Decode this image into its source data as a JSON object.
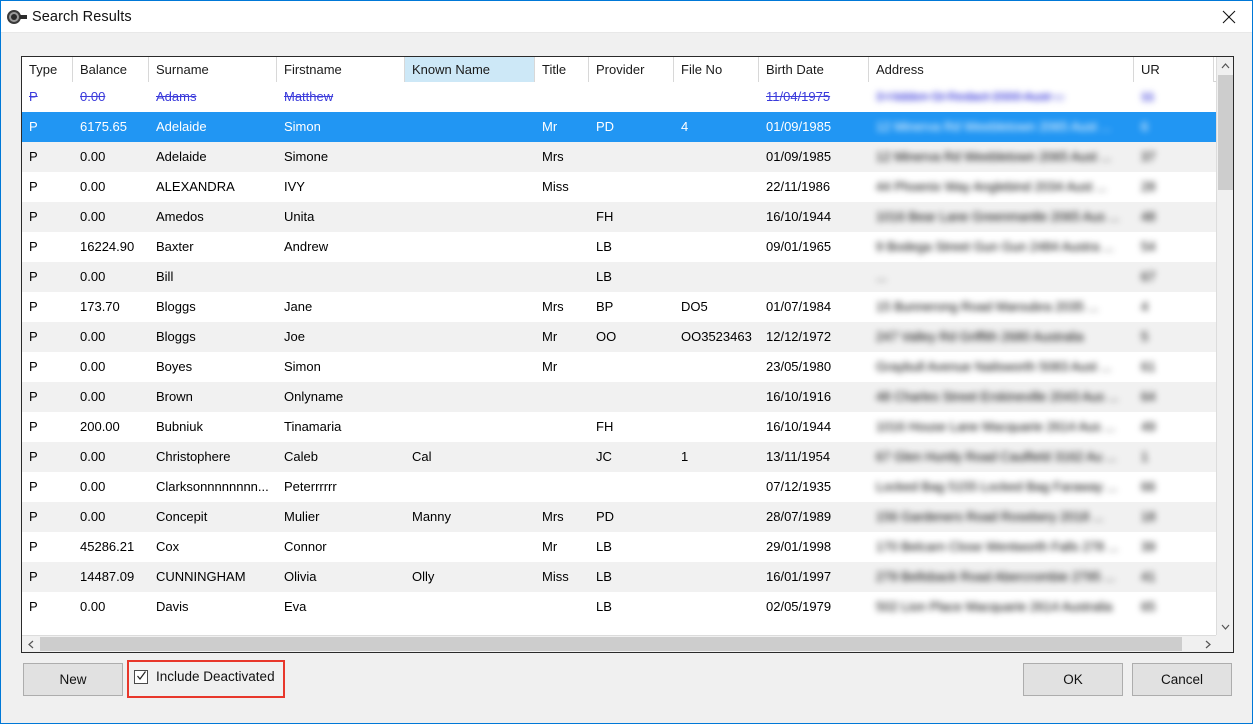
{
  "window": {
    "title": "Search Results",
    "title_icon": "search-magnifier-icon",
    "close_icon": "close-icon",
    "accent_color": "#0078d7",
    "selection_color": "#2196f3",
    "deactivated_color": "#3b3bdb",
    "annotation_color": "#e8372b",
    "header_highlight_color": "#cde8f7"
  },
  "grid": {
    "sorted_column": "Known Name",
    "columns": [
      {
        "label": "Type",
        "key": "type"
      },
      {
        "label": "Balance",
        "key": "balance"
      },
      {
        "label": "Surname",
        "key": "surname"
      },
      {
        "label": "Firstname",
        "key": "firstname"
      },
      {
        "label": "Known Name",
        "key": "known_name"
      },
      {
        "label": "Title",
        "key": "title"
      },
      {
        "label": "Provider",
        "key": "provider"
      },
      {
        "label": "File No",
        "key": "file_no"
      },
      {
        "label": "Birth Date",
        "key": "birth_date"
      },
      {
        "label": "Address",
        "key": "address"
      },
      {
        "label": "UR",
        "key": "ur"
      }
    ],
    "rows": [
      {
        "type": "P",
        "balance": "0.00",
        "surname": "Adams",
        "firstname": "Matthew",
        "known_name": "",
        "title": "",
        "provider": "",
        "file_no": "",
        "birth_date": "11/04/1975",
        "address": "3 Hidden St Redact 2000 Aust ...",
        "ur": "11",
        "state": "deactivated"
      },
      {
        "type": "P",
        "balance": "6175.65",
        "surname": "Adelaide",
        "firstname": "Simon",
        "known_name": "",
        "title": "Mr",
        "provider": "PD",
        "file_no": "4",
        "birth_date": "01/09/1985",
        "address": "12 Minerva Rd Weebletown 2065 Aust ...",
        "ur": "6",
        "state": "selected"
      },
      {
        "type": "P",
        "balance": "0.00",
        "surname": "Adelaide",
        "firstname": "Simone",
        "known_name": "",
        "title": "Mrs",
        "provider": "",
        "file_no": "",
        "birth_date": "01/09/1985",
        "address": "12 Minerva Rd Weebletown 2065 Aust ...",
        "ur": "37",
        "state": "alt"
      },
      {
        "type": "P",
        "balance": "0.00",
        "surname": "ALEXANDRA",
        "firstname": "IVY",
        "known_name": "",
        "title": "Miss",
        "provider": "",
        "file_no": "",
        "birth_date": "22/11/1986",
        "address": "44 Phoenix Way Anglebind 2034 Aust ...",
        "ur": "28",
        "state": ""
      },
      {
        "type": "P",
        "balance": "0.00",
        "surname": "Amedos",
        "firstname": "Unita",
        "known_name": "",
        "title": "",
        "provider": "FH",
        "file_no": "",
        "birth_date": "16/10/1944",
        "address": "1016 Bear Lane Greenmantle 2065 Aus ...",
        "ur": "48",
        "state": "alt"
      },
      {
        "type": "P",
        "balance": "16224.90",
        "surname": "Baxter",
        "firstname": "Andrew",
        "known_name": "",
        "title": "",
        "provider": "LB",
        "file_no": "",
        "birth_date": "09/01/1965",
        "address": "9 Bodega Street Gun Gun 2484 Austra ...",
        "ur": "54",
        "state": ""
      },
      {
        "type": "P",
        "balance": "0.00",
        "surname": "Bill",
        "firstname": "",
        "known_name": "",
        "title": "",
        "provider": "LB",
        "file_no": "",
        "birth_date": "",
        "address": "...",
        "ur": "67",
        "state": "alt"
      },
      {
        "type": "P",
        "balance": "173.70",
        "surname": "Bloggs",
        "firstname": "Jane",
        "known_name": "",
        "title": "Mrs",
        "provider": "BP",
        "file_no": "DO5",
        "birth_date": "01/07/1984",
        "address": "15 Bunnerong Road  Maroubra  2035 ...",
        "ur": "4",
        "state": ""
      },
      {
        "type": "P",
        "balance": "0.00",
        "surname": "Bloggs",
        "firstname": "Joe",
        "known_name": "",
        "title": "Mr",
        "provider": "OO",
        "file_no": "OO3523463",
        "birth_date": "12/12/1972",
        "address": "247 Valley Rd Griffith  2680  Australia",
        "ur": "5",
        "state": "alt"
      },
      {
        "type": "P",
        "balance": "0.00",
        "surname": "Boyes",
        "firstname": "Simon",
        "known_name": "",
        "title": "Mr",
        "provider": "",
        "file_no": "",
        "birth_date": "23/05/1980",
        "address": "Graybull Avenue  Nailsworth  5083 Aust ...",
        "ur": "61",
        "state": ""
      },
      {
        "type": "P",
        "balance": "0.00",
        "surname": "Brown",
        "firstname": "Onlyname",
        "known_name": "",
        "title": "",
        "provider": "",
        "file_no": "",
        "birth_date": "16/10/1916",
        "address": "48 Charles Street  Erskineville  2043  Aus ...",
        "ur": "64",
        "state": "alt"
      },
      {
        "type": "P",
        "balance": "200.00",
        "surname": "Bubniuk",
        "firstname": "Tinamaria",
        "known_name": "",
        "title": "",
        "provider": "FH",
        "file_no": "",
        "birth_date": "16/10/1944",
        "address": "1016 House Lane  Macquarie  2614  Aus ...",
        "ur": "49",
        "state": ""
      },
      {
        "type": "P",
        "balance": "0.00",
        "surname": "Christophere",
        "firstname": "Caleb",
        "known_name": "Cal",
        "title": "",
        "provider": "JC",
        "file_no": "1",
        "birth_date": "13/11/1954",
        "address": "67 Glen Huntly Road  Caulfield  3162  Au ...",
        "ur": "1",
        "state": "alt"
      },
      {
        "type": "P",
        "balance": "0.00",
        "surname": "Clarksonnnnnnnn...",
        "firstname": "Peterrrrrr",
        "known_name": "",
        "title": "",
        "provider": "",
        "file_no": "",
        "birth_date": "07/12/1935",
        "address": "Locked Bag 5155 Locked Bag  Faraway ...",
        "ur": "66",
        "state": ""
      },
      {
        "type": "P",
        "balance": "0.00",
        "surname": "Concepit",
        "firstname": "Mulier",
        "known_name": "Manny",
        "title": "Mrs",
        "provider": "PD",
        "file_no": "",
        "birth_date": "28/07/1989",
        "address": "156 Gardeners Road  Rosebery  2018 ...",
        "ur": "18",
        "state": "alt"
      },
      {
        "type": "P",
        "balance": "45286.21",
        "surname": "Cox",
        "firstname": "Connor",
        "known_name": "",
        "title": "Mr",
        "provider": "LB",
        "file_no": "",
        "birth_date": "29/01/1998",
        "address": "170 Belcarn Close  Wentworth Falls  278 ...",
        "ur": "39",
        "state": ""
      },
      {
        "type": "P",
        "balance": "14487.09",
        "surname": "CUNNINGHAM",
        "firstname": "Olivia",
        "known_name": "Olly",
        "title": "Miss",
        "provider": "LB",
        "file_no": "",
        "birth_date": "16/01/1997",
        "address": "279 Bellsback Road  Abercrombie  2795 ...",
        "ur": "41",
        "state": "alt"
      },
      {
        "type": "P",
        "balance": "0.00",
        "surname": "Davis",
        "firstname": "Eva",
        "known_name": "",
        "title": "",
        "provider": "LB",
        "file_no": "",
        "birth_date": "02/05/1979",
        "address": "502 Lion Place  Macquarie  2614  Australia",
        "ur": "65",
        "state": ""
      }
    ]
  },
  "scrollbars": {
    "vertical_up_icon": "chevron-up-icon",
    "vertical_down_icon": "chevron-down-icon",
    "horizontal_left_icon": "chevron-left-icon",
    "horizontal_right_icon": "chevron-right-icon"
  },
  "footer": {
    "new_label": "New",
    "ok_label": "OK",
    "cancel_label": "Cancel",
    "include_deactivated_label": "Include Deactivated",
    "include_deactivated_checked": true
  }
}
